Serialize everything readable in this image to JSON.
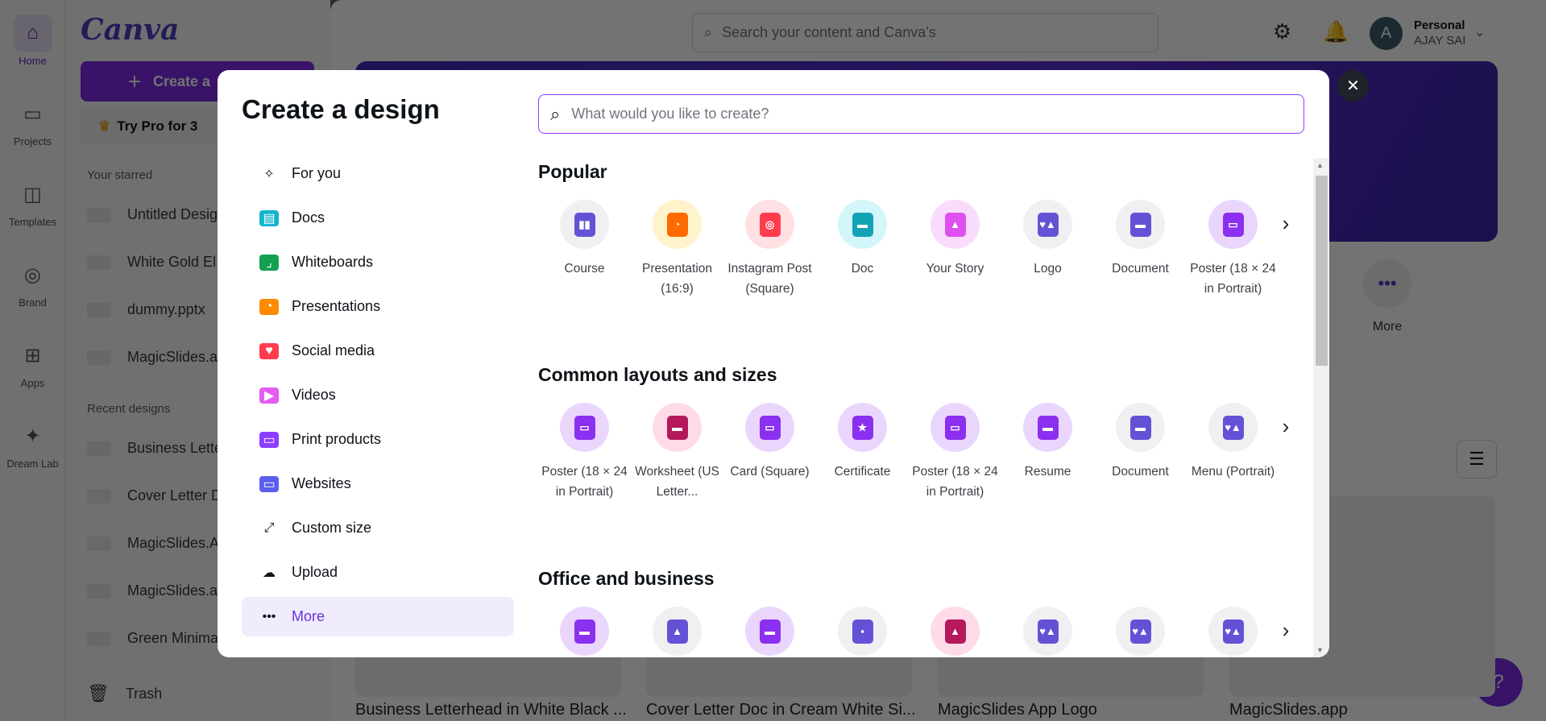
{
  "rail": [
    {
      "label": "Home",
      "icon": "home-icon",
      "active": true
    },
    {
      "label": "Projects",
      "icon": "folder-icon"
    },
    {
      "label": "Templates",
      "icon": "templates-icon"
    },
    {
      "label": "Brand",
      "icon": "brand-icon"
    },
    {
      "label": "Apps",
      "icon": "apps-icon"
    },
    {
      "label": "Dream Lab",
      "icon": "dream-lab-icon"
    }
  ],
  "sidebar": {
    "logo": "Canva",
    "create_label": "Create a",
    "pro_label": "Try Pro for 3",
    "starred_heading": "Your starred",
    "starred": [
      "Untitled Desig",
      "White Gold El",
      "dummy.pptx",
      "MagicSlides.a"
    ],
    "recent_heading": "Recent designs",
    "recent": [
      "Business Lette",
      "Cover Letter D",
      "MagicSlides.A",
      "MagicSlides.a",
      "Green Minima"
    ],
    "trash": "Trash"
  },
  "header": {
    "search_placeholder": "Search your content and Canva's",
    "avatar_letter": "A",
    "account_type": "Personal",
    "account_name": "AJAY SAI"
  },
  "main": {
    "more_label": "More",
    "cards": [
      "Business Letterhead in White Black ...",
      "Cover Letter Doc in Cream White Si...",
      "MagicSlides App Logo",
      "MagicSlides.app"
    ],
    "help": "?"
  },
  "modal": {
    "title": "Create a design",
    "search_placeholder": "What would you like to create?",
    "nav": [
      {
        "label": "For you",
        "icon": "sparkle-icon",
        "color": "#0e1318",
        "glyph": "✧"
      },
      {
        "label": "Docs",
        "icon": "docs-icon",
        "color": "#13b5cf",
        "glyph": "▤"
      },
      {
        "label": "Whiteboards",
        "icon": "whiteboard-icon",
        "color": "#12a150",
        "glyph": "⌟"
      },
      {
        "label": "Presentations",
        "icon": "presentation-icon",
        "color": "#ff8a00",
        "glyph": "◔"
      },
      {
        "label": "Social media",
        "icon": "heart-icon",
        "color": "#ff3b4e",
        "glyph": "♥"
      },
      {
        "label": "Videos",
        "icon": "video-icon",
        "color": "#e45cf0",
        "glyph": "▶"
      },
      {
        "label": "Print products",
        "icon": "printer-icon",
        "color": "#8b3dff",
        "glyph": "▭"
      },
      {
        "label": "Websites",
        "icon": "website-icon",
        "color": "#5b5ef0",
        "glyph": "▭"
      },
      {
        "label": "Custom size",
        "icon": "custom-size-icon",
        "color": "#0e1318",
        "glyph": "⤢"
      },
      {
        "label": "Upload",
        "icon": "upload-cloud-icon",
        "color": "#0e1318",
        "glyph": "☁"
      },
      {
        "label": "More",
        "icon": "more-dots-icon",
        "color": "#0e1318",
        "glyph": "•••",
        "active": true
      }
    ],
    "sections": [
      {
        "title": "Popular",
        "items": [
          {
            "label": "Course",
            "bg": "#f0f0f3",
            "fg": "#6452d6",
            "g": "▮▮"
          },
          {
            "label": "Presentation (16:9)",
            "bg": "#fff3cc",
            "fg": "#ff6a00",
            "g": "◔"
          },
          {
            "label": "Instagram Post (Square)",
            "bg": "#ffe0e3",
            "fg": "#ff3b4e",
            "g": "◎"
          },
          {
            "label": "Doc",
            "bg": "#d3f6fb",
            "fg": "#13a3b5",
            "g": "▬"
          },
          {
            "label": "Your Story",
            "bg": "#f9dcfb",
            "fg": "#e050f0",
            "g": "▲"
          },
          {
            "label": "Logo",
            "bg": "#f0f0f3",
            "fg": "#6452d6",
            "g": "♥▲"
          },
          {
            "label": "Document",
            "bg": "#f0f0f3",
            "fg": "#6452d6",
            "g": "▬"
          },
          {
            "label": "Poster (18 × 24 in Portrait)",
            "bg": "#ead6fd",
            "fg": "#8b2ff0",
            "g": "▭"
          }
        ]
      },
      {
        "title": "Common layouts and sizes",
        "items": [
          {
            "label": "Poster (18 × 24 in Portrait)",
            "bg": "#ead6fd",
            "fg": "#8b2ff0",
            "g": "▭"
          },
          {
            "label": "Worksheet (US Letter...",
            "bg": "#ffdbe8",
            "fg": "#b3195c",
            "g": "▬"
          },
          {
            "label": "Card (Square)",
            "bg": "#ead6fd",
            "fg": "#8b2ff0",
            "g": "▭"
          },
          {
            "label": "Certificate",
            "bg": "#ead6fd",
            "fg": "#8b2ff0",
            "g": "★"
          },
          {
            "label": "Poster (18 × 24 in Portrait)",
            "bg": "#ead6fd",
            "fg": "#8b2ff0",
            "g": "▭"
          },
          {
            "label": "Resume",
            "bg": "#ead6fd",
            "fg": "#8b2ff0",
            "g": "▬"
          },
          {
            "label": "Document",
            "bg": "#f0f0f3",
            "fg": "#6452d6",
            "g": "▬"
          },
          {
            "label": "Menu (Portrait)",
            "bg": "#f0f0f3",
            "fg": "#6452d6",
            "g": "♥▲"
          }
        ]
      },
      {
        "title": "Office and business",
        "items": [
          {
            "label": "",
            "bg": "#ead6fd",
            "fg": "#8b2ff0",
            "g": "▬"
          },
          {
            "label": "",
            "bg": "#f0f0f3",
            "fg": "#6452d6",
            "g": "▲"
          },
          {
            "label": "",
            "bg": "#ead6fd",
            "fg": "#8b2ff0",
            "g": "▬"
          },
          {
            "label": "",
            "bg": "#f0f0f3",
            "fg": "#6452d6",
            "g": "▪"
          },
          {
            "label": "",
            "bg": "#ffdbe8",
            "fg": "#b3195c",
            "g": "▲"
          },
          {
            "label": "",
            "bg": "#f0f0f3",
            "fg": "#6452d6",
            "g": "♥▲"
          },
          {
            "label": "",
            "bg": "#f0f0f3",
            "fg": "#6452d6",
            "g": "♥▲"
          },
          {
            "label": "",
            "bg": "#f0f0f3",
            "fg": "#6452d6",
            "g": "♥▲"
          }
        ]
      }
    ]
  }
}
